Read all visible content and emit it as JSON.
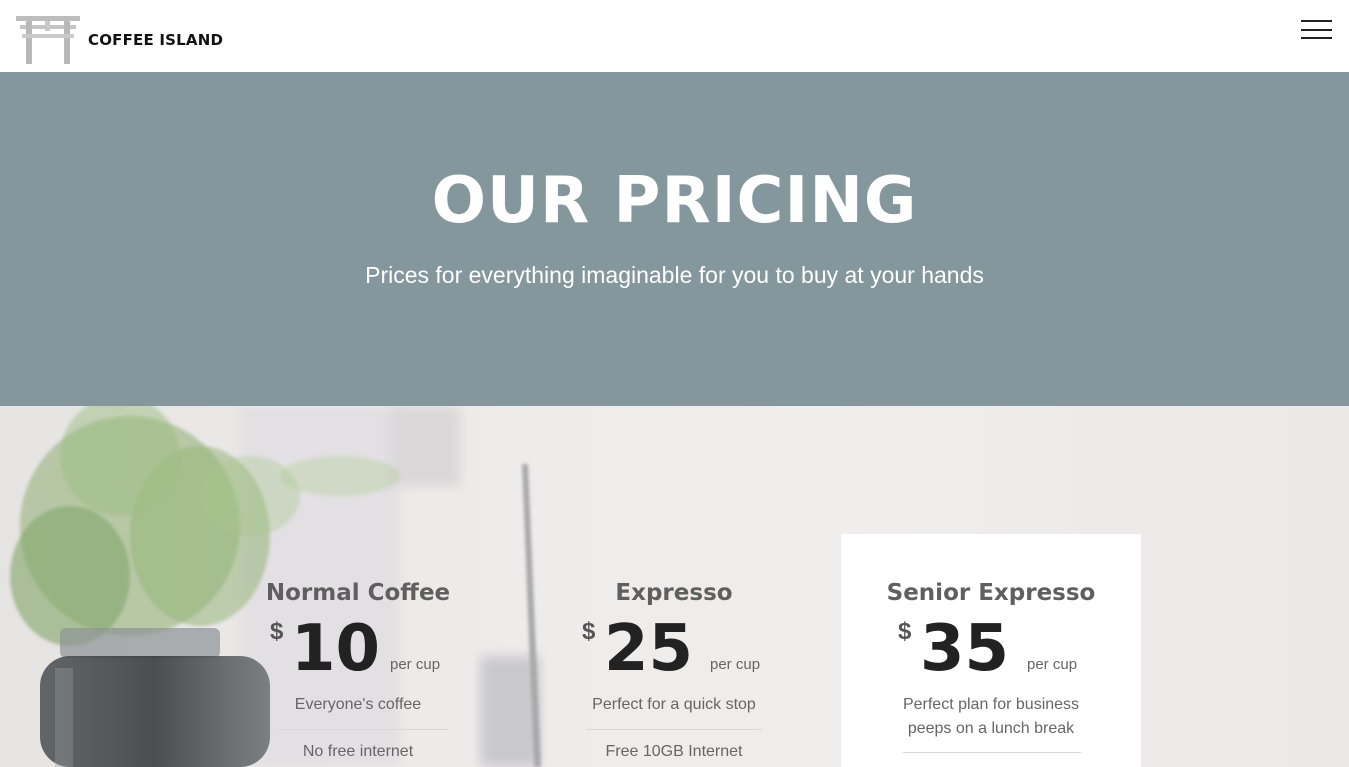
{
  "header": {
    "brand": "COFFEE ISLAND",
    "logo_icon": "torii-gate-icon",
    "menu_icon": "hamburger-menu-icon"
  },
  "hero": {
    "title": "OUR PRICING",
    "subtitle": "Prices for everything imaginable for you to buy at your hands",
    "background_color": "#84979c"
  },
  "plans": [
    {
      "name": "Normal Coffee",
      "currency": "$",
      "price": "10",
      "unit": "per cup",
      "features": [
        "Everyone's coffee",
        "No free internet"
      ]
    },
    {
      "name": "Expresso",
      "currency": "$",
      "price": "25",
      "unit": "per cup",
      "features": [
        "Perfect for a quick stop",
        "Free 10GB Internet"
      ]
    },
    {
      "name": "Senior Expresso",
      "currency": "$",
      "price": "35",
      "unit": "per cup",
      "features": [
        "Perfect plan for business",
        "peeps on a lunch break"
      ]
    }
  ]
}
